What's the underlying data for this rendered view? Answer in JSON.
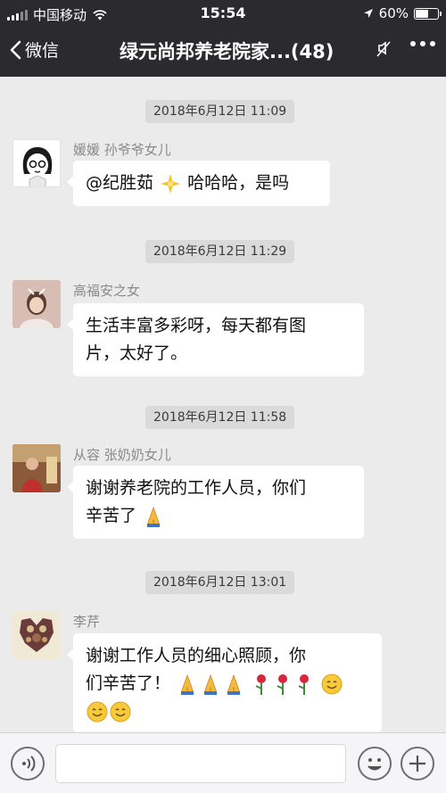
{
  "status_bar": {
    "carrier": "中国移动",
    "time": "15:54",
    "battery_percent": "60%",
    "battery_level": 0.6
  },
  "nav": {
    "back_label": "微信",
    "title": "绿元尚邦养老院家...(48)"
  },
  "messages": [
    {
      "timestamp": "2018年6月12日 11:09",
      "sender": "媛媛  孙爷爷女儿",
      "text_before": "@纪胜茹",
      "emoji": "sparkle-star-emoji",
      "text_after": " 哈哈哈，是吗"
    },
    {
      "timestamp": "2018年6月12日 11:29",
      "sender": "高福安之女",
      "text_line1": "生活丰富多彩呀，每天都有图",
      "text_line2": "片，太好了。"
    },
    {
      "timestamp": "2018年6月12日 11:58",
      "sender": "从容  张奶奶女儿",
      "text_line1": "谢谢养老院的工作人员，你们",
      "text_line2": "辛苦了",
      "emoji": "folded-hands-emoji"
    },
    {
      "timestamp": "2018年6月12日 13:01",
      "sender": "李芹",
      "text_line1": "谢谢工作人员的细心照顾，你",
      "text_line2": "们辛苦了！",
      "emojis_line2": [
        "folded-hands-emoji",
        "folded-hands-emoji",
        "folded-hands-emoji",
        "rose-emoji",
        "rose-emoji",
        "rose-emoji",
        "smiling-face-emoji"
      ],
      "emojis_line3": [
        "smiling-face-emoji",
        "smiling-face-emoji"
      ]
    }
  ],
  "colors": {
    "header_bg": "#2b2b2f",
    "chat_bg": "#ebebeb",
    "bubble_bg": "#ffffff",
    "timestamp_bg": "#dadada"
  },
  "icons": [
    "signal-icon",
    "wifi-icon",
    "location-arrow-icon",
    "battery-icon",
    "back-chevron-icon",
    "mute-icon",
    "more-icon",
    "voice-icon",
    "emoji-icon",
    "plus-icon"
  ]
}
